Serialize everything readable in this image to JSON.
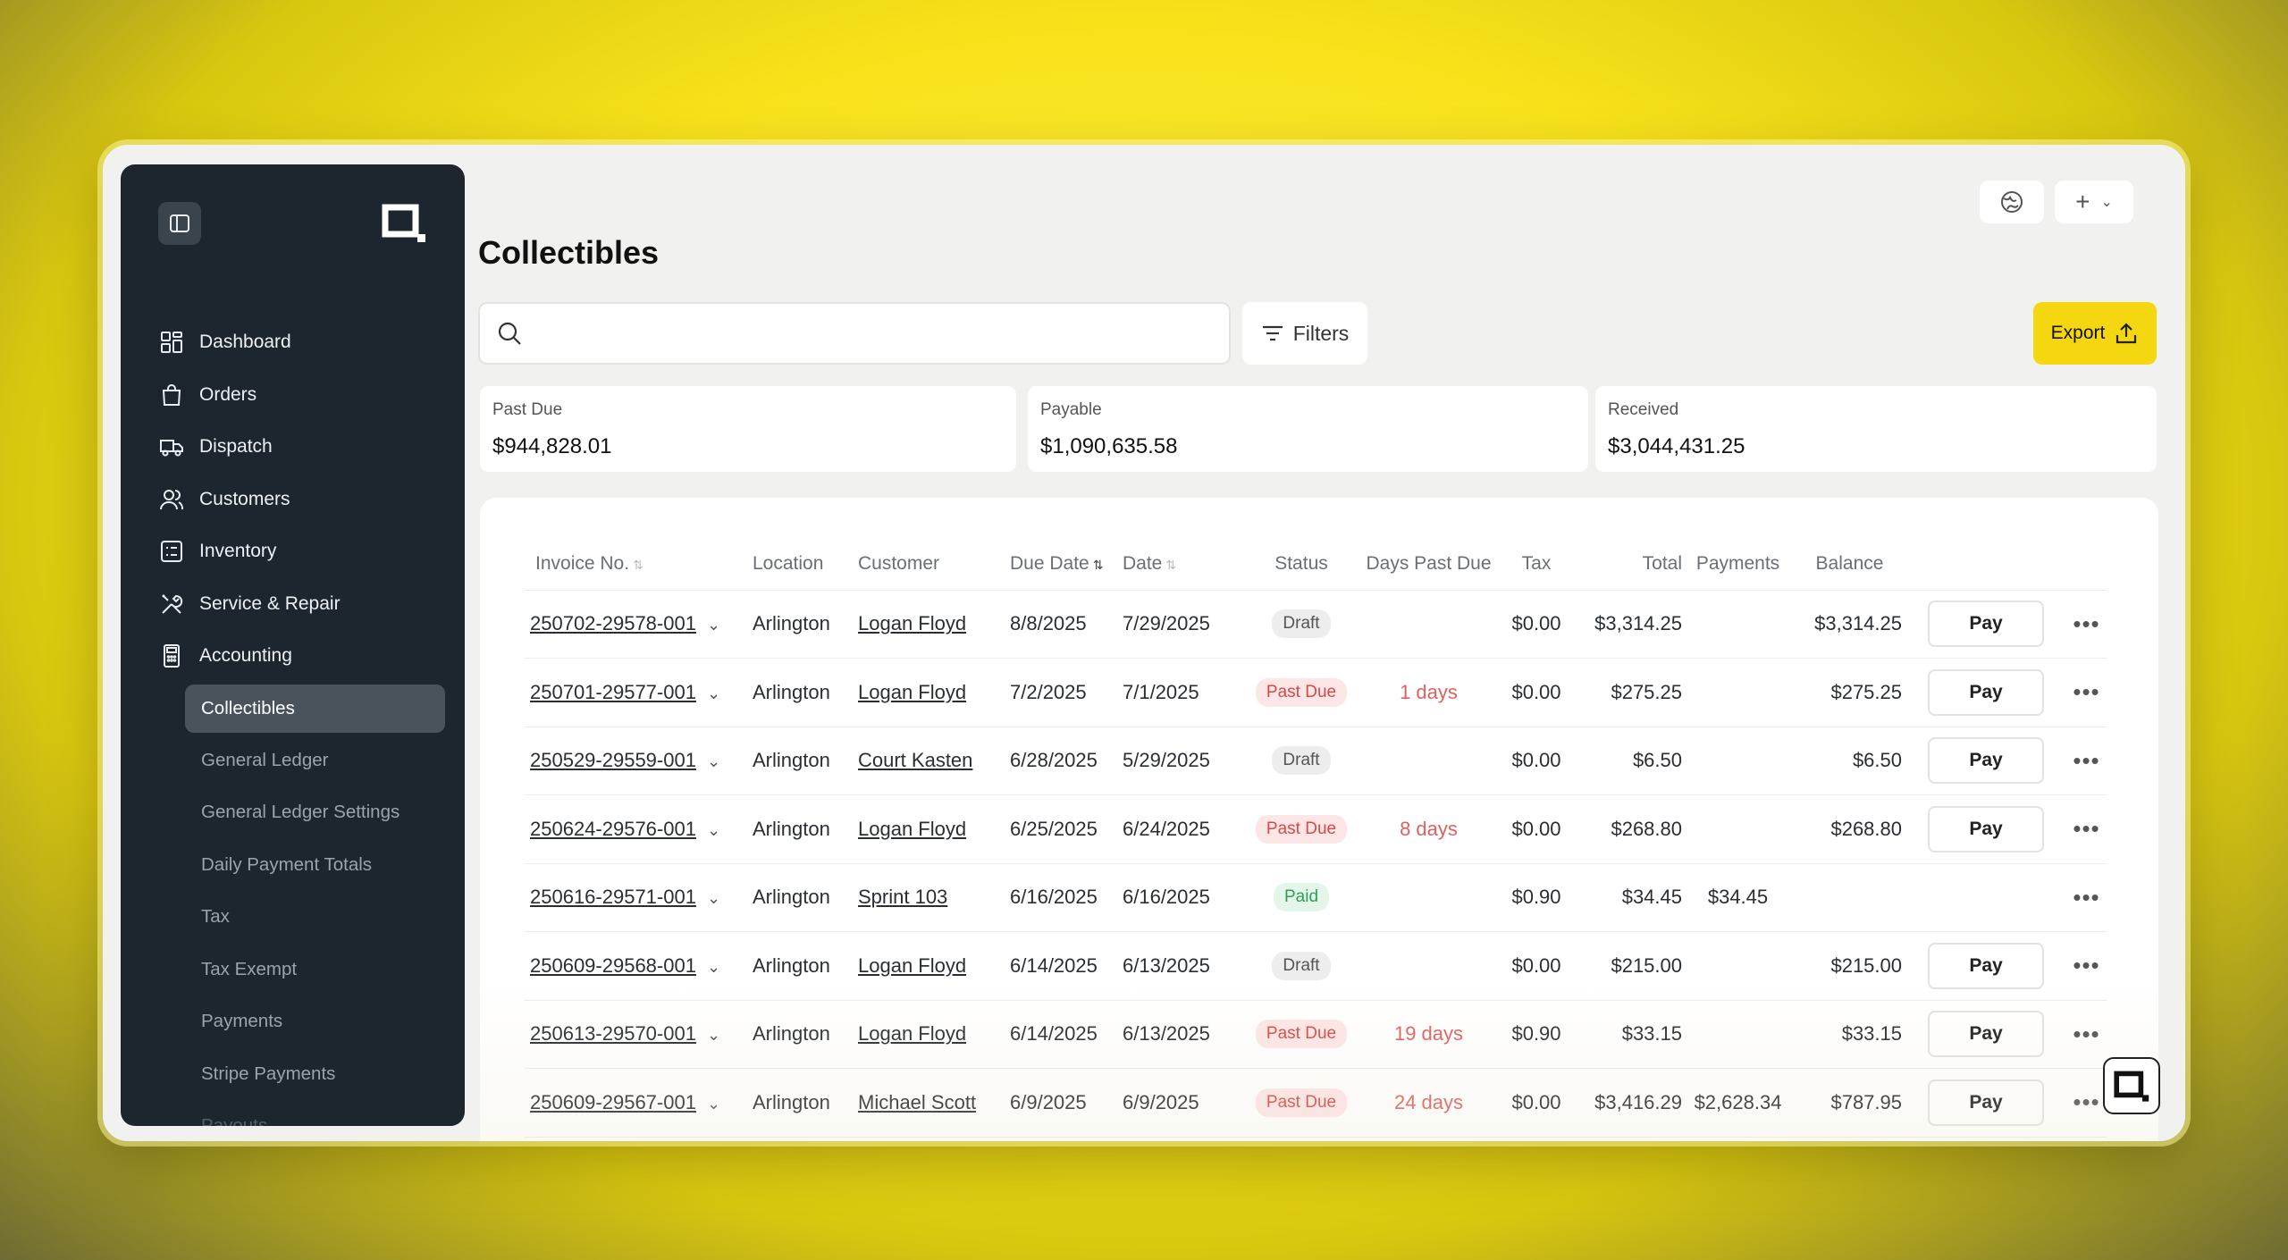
{
  "sidebar": {
    "nav": [
      {
        "label": "Dashboard",
        "icon": "dashboard-icon"
      },
      {
        "label": "Orders",
        "icon": "shopping-bag-icon"
      },
      {
        "label": "Dispatch",
        "icon": "truck-icon"
      },
      {
        "label": "Customers",
        "icon": "users-icon"
      },
      {
        "label": "Inventory",
        "icon": "checklist-icon"
      },
      {
        "label": "Service & Repair",
        "icon": "tools-icon"
      },
      {
        "label": "Accounting",
        "icon": "calculator-icon"
      }
    ],
    "sub": [
      {
        "label": "Collectibles",
        "active": true
      },
      {
        "label": "General Ledger"
      },
      {
        "label": "General Ledger Settings"
      },
      {
        "label": "Daily Payment Totals"
      },
      {
        "label": "Tax"
      },
      {
        "label": "Tax Exempt"
      },
      {
        "label": "Payments"
      },
      {
        "label": "Stripe Payments"
      },
      {
        "label": "Payouts"
      }
    ]
  },
  "page": {
    "title": "Collectibles",
    "search_placeholder": "",
    "filters_label": "Filters",
    "export_label": "Export"
  },
  "summary": {
    "past_due": {
      "label": "Past Due",
      "value": "$944,828.01"
    },
    "payable": {
      "label": "Payable",
      "value": "$1,090,635.58"
    },
    "received": {
      "label": "Received",
      "value": "$3,044,431.25"
    }
  },
  "table": {
    "headers": {
      "invoice": "Invoice No.",
      "location": "Location",
      "customer": "Customer",
      "due_date": "Due Date",
      "date": "Date",
      "status": "Status",
      "days_past_due": "Days Past Due",
      "tax": "Tax",
      "total": "Total",
      "payments": "Payments",
      "balance": "Balance"
    },
    "pay_label": "Pay",
    "rows": [
      {
        "invoice": "250702-29578-001",
        "location": "Arlington",
        "customer": "Logan Floyd",
        "due": "8/8/2025",
        "date": "7/29/2025",
        "status": "Draft",
        "dpd": "",
        "tax": "$0.00",
        "total": "$3,314.25",
        "payments": "",
        "balance": "$3,314.25",
        "pay": true
      },
      {
        "invoice": "250701-29577-001",
        "location": "Arlington",
        "customer": "Logan Floyd",
        "due": "7/2/2025",
        "date": "7/1/2025",
        "status": "Past Due",
        "dpd": "1 days",
        "tax": "$0.00",
        "total": "$275.25",
        "payments": "",
        "balance": "$275.25",
        "pay": true
      },
      {
        "invoice": "250529-29559-001",
        "location": "Arlington",
        "customer": "Court Kasten",
        "due": "6/28/2025",
        "date": "5/29/2025",
        "status": "Draft",
        "dpd": "",
        "tax": "$0.00",
        "total": "$6.50",
        "payments": "",
        "balance": "$6.50",
        "pay": true
      },
      {
        "invoice": "250624-29576-001",
        "location": "Arlington",
        "customer": "Logan Floyd",
        "due": "6/25/2025",
        "date": "6/24/2025",
        "status": "Past Due",
        "dpd": "8 days",
        "tax": "$0.00",
        "total": "$268.80",
        "payments": "",
        "balance": "$268.80",
        "pay": true
      },
      {
        "invoice": "250616-29571-001",
        "location": "Arlington",
        "customer": "Sprint 103",
        "due": "6/16/2025",
        "date": "6/16/2025",
        "status": "Paid",
        "dpd": "",
        "tax": "$0.90",
        "total": "$34.45",
        "payments": "$34.45",
        "balance": "",
        "pay": false
      },
      {
        "invoice": "250609-29568-001",
        "location": "Arlington",
        "customer": "Logan Floyd",
        "due": "6/14/2025",
        "date": "6/13/2025",
        "status": "Draft",
        "dpd": "",
        "tax": "$0.00",
        "total": "$215.00",
        "payments": "",
        "balance": "$215.00",
        "pay": true
      },
      {
        "invoice": "250613-29570-001",
        "location": "Arlington",
        "customer": "Logan Floyd",
        "due": "6/14/2025",
        "date": "6/13/2025",
        "status": "Past Due",
        "dpd": "19 days",
        "tax": "$0.90",
        "total": "$33.15",
        "payments": "",
        "balance": "$33.15",
        "pay": true
      },
      {
        "invoice": "250609-29567-001",
        "location": "Arlington",
        "customer": "Michael Scott",
        "due": "6/9/2025",
        "date": "6/9/2025",
        "status": "Past Due",
        "dpd": "24 days",
        "tax": "$0.00",
        "total": "$3,416.29",
        "payments": "$2,628.34",
        "balance": "$787.95",
        "pay": true
      }
    ]
  },
  "colors": {
    "accent": "#f5d711",
    "sidebar_bg": "#1d262e",
    "past_due": "#d94848",
    "paid": "#2e9e57"
  }
}
